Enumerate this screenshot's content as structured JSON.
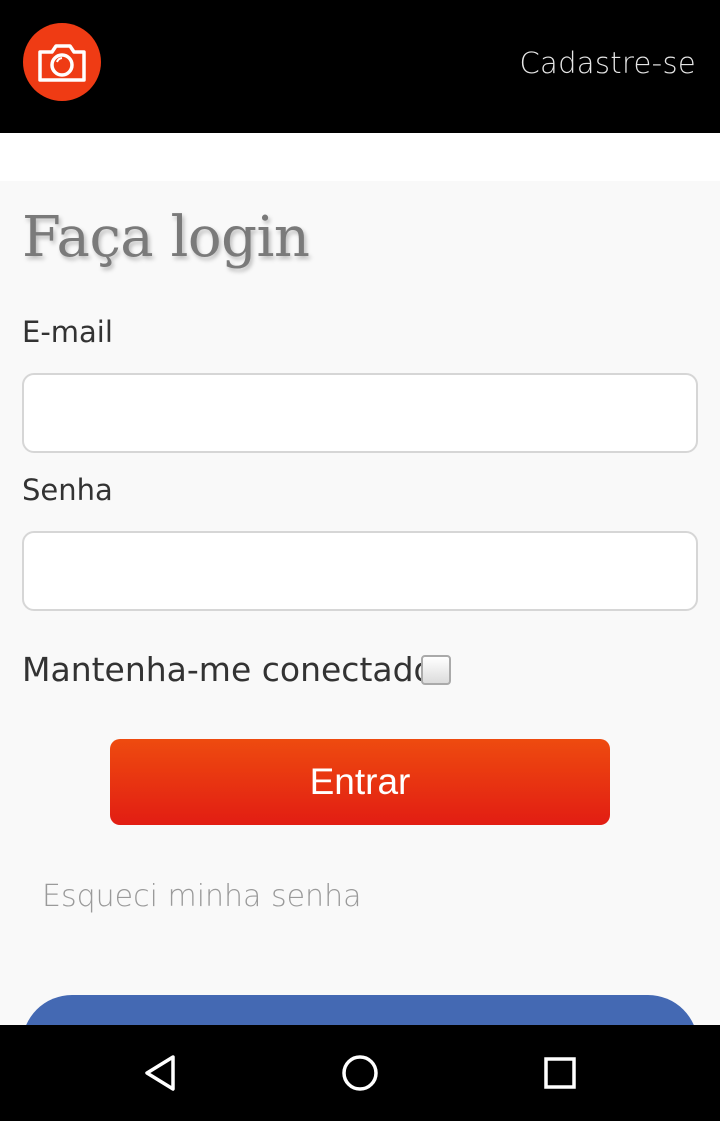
{
  "header": {
    "logo_icon": "camera-icon",
    "logo_color": "#ef3b14",
    "signup_link": "Cadastre-se"
  },
  "form": {
    "title": "Faça login",
    "email_label": "E-mail",
    "email_value": "",
    "password_label": "Senha",
    "password_value": "",
    "remember_label": "Mantenha-me conectado",
    "remember_checked": false,
    "login_button": "Entrar",
    "login_button_color": "#e8300f",
    "forgot_link": "Esqueci minha senha",
    "secondary_button_color": "#4469b3"
  },
  "system_nav": {
    "back_icon": "back-triangle-icon",
    "home_icon": "home-circle-icon",
    "recents_icon": "recents-square-icon"
  }
}
